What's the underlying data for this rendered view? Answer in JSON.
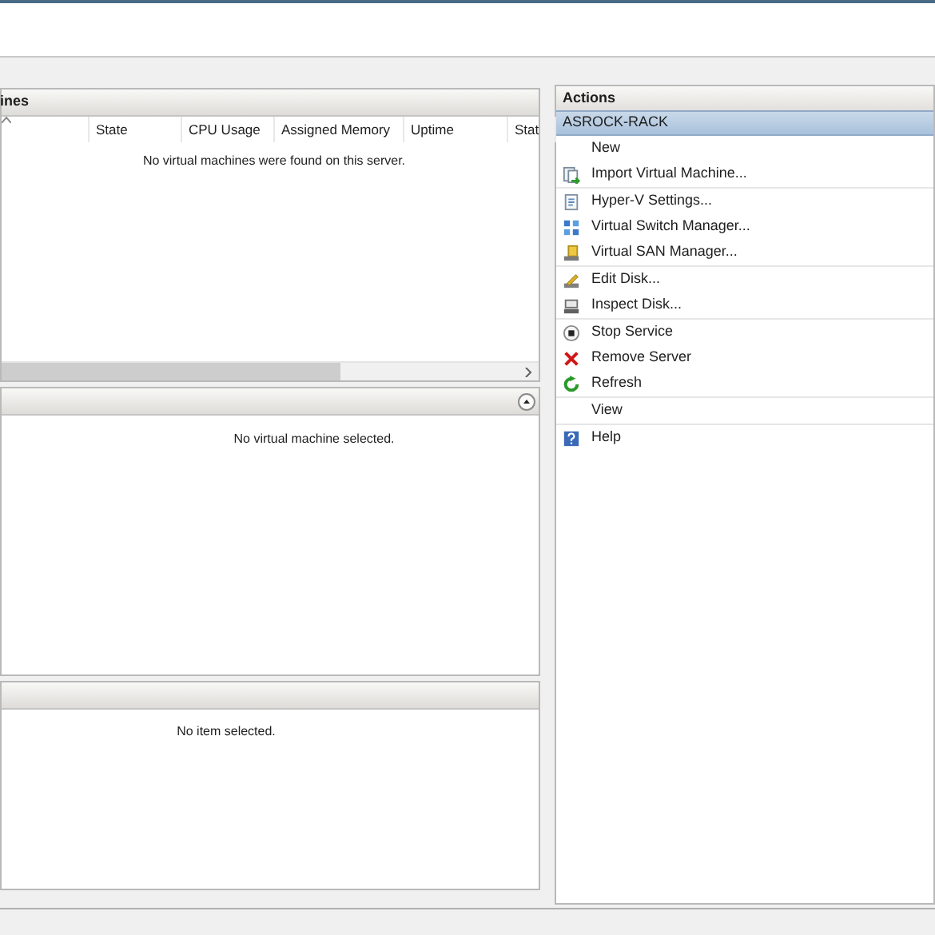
{
  "vm_panel": {
    "title": "ines",
    "columns": [
      {
        "sorted": true
      },
      {
        "label": "State",
        "sorted": false
      },
      {
        "label": "CPU Usage",
        "sorted": false
      },
      {
        "label": "Assigned Memory",
        "sorted": false
      },
      {
        "label": "Uptime",
        "sorted": false
      },
      {
        "label": "Stat",
        "sorted": false
      }
    ],
    "empty_message": "No virtual machines were found on this server."
  },
  "details_panel": {
    "empty_message": "No virtual machine selected."
  },
  "item_panel": {
    "empty_message": "No item selected."
  },
  "actions": {
    "title": "Actions",
    "server": "ASROCK-RACK",
    "groups": [
      [
        {
          "label": "New",
          "kind": "plain"
        },
        {
          "label": "Import Virtual Machine...",
          "kind": "import"
        }
      ],
      [
        {
          "label": "Hyper-V Settings...",
          "kind": "settings"
        },
        {
          "label": "Virtual Switch Manager...",
          "kind": "switch"
        },
        {
          "label": "Virtual SAN Manager...",
          "kind": "san"
        }
      ],
      [
        {
          "label": "Edit Disk...",
          "kind": "edit"
        },
        {
          "label": "Inspect Disk...",
          "kind": "inspect"
        }
      ],
      [
        {
          "label": "Stop Service",
          "kind": "stop"
        },
        {
          "label": "Remove Server",
          "kind": "remove"
        },
        {
          "label": "Refresh",
          "kind": "refresh"
        }
      ],
      [
        {
          "label": "View",
          "kind": "plain"
        }
      ],
      [
        {
          "label": "Help",
          "kind": "help"
        }
      ]
    ]
  }
}
